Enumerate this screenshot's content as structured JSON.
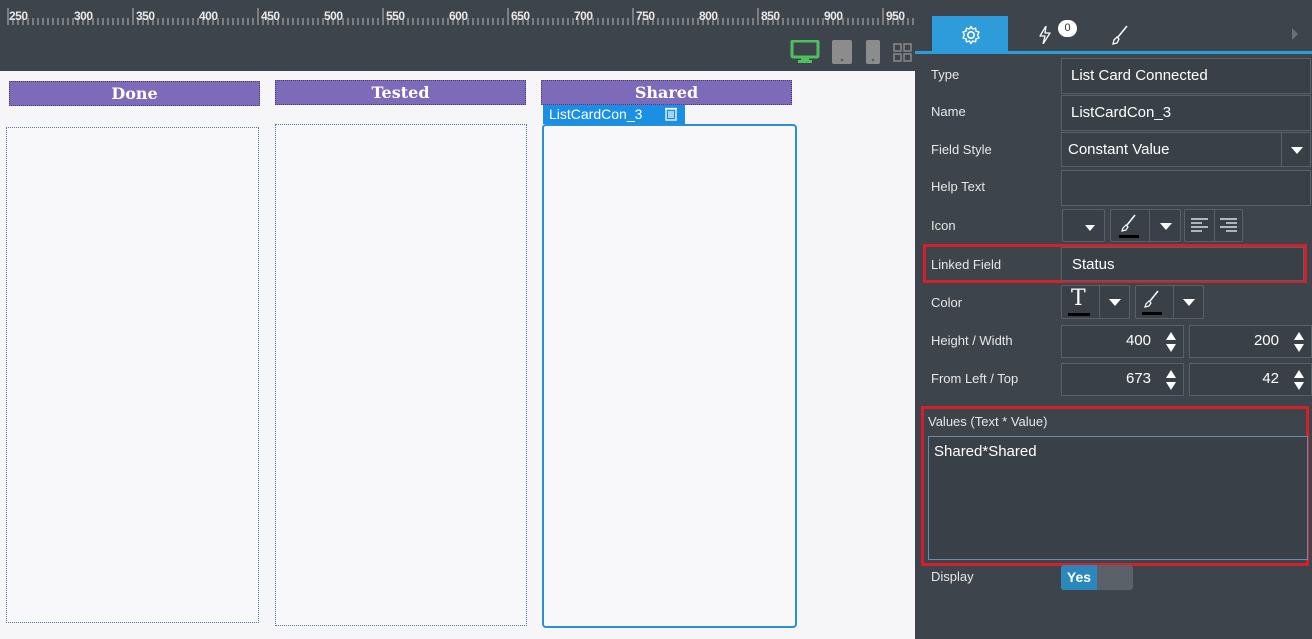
{
  "ruler": {
    "labels": [
      "250",
      "300",
      "350",
      "400",
      "450",
      "500",
      "550",
      "600",
      "650",
      "700",
      "750",
      "800",
      "850",
      "900",
      "950"
    ]
  },
  "toolbar": {
    "devices": [
      "desktop-icon",
      "tablet-icon",
      "phone-icon",
      "grid-icon"
    ]
  },
  "canvas": {
    "columns": [
      {
        "title": "Done"
      },
      {
        "title": "Tested"
      },
      {
        "title": "Shared"
      }
    ],
    "selected_component": "ListCardCon_3"
  },
  "panel": {
    "tabs": {
      "events_count": "0"
    },
    "type": {
      "label": "Type",
      "value": "List Card Connected"
    },
    "name": {
      "label": "Name",
      "value": "ListCardCon_3"
    },
    "field_style": {
      "label": "Field Style",
      "value": "Constant Value"
    },
    "help_text": {
      "label": "Help Text",
      "value": ""
    },
    "icon": {
      "label": "Icon"
    },
    "linked_field": {
      "label": "Linked Field",
      "value": "Status"
    },
    "color": {
      "label": "Color"
    },
    "height_width": {
      "label": "Height / Width",
      "height": "400",
      "width": "200"
    },
    "left_top": {
      "label": "From Left / Top",
      "left": "673",
      "top": "42"
    },
    "values": {
      "label": "Values (Text * Value)",
      "value": "Shared*Shared"
    },
    "display": {
      "label": "Display",
      "value": "Yes"
    }
  },
  "colors": {
    "accent": "#2e9cdb",
    "column_header": "#7d6ab8",
    "highlight": "#d4202a"
  }
}
